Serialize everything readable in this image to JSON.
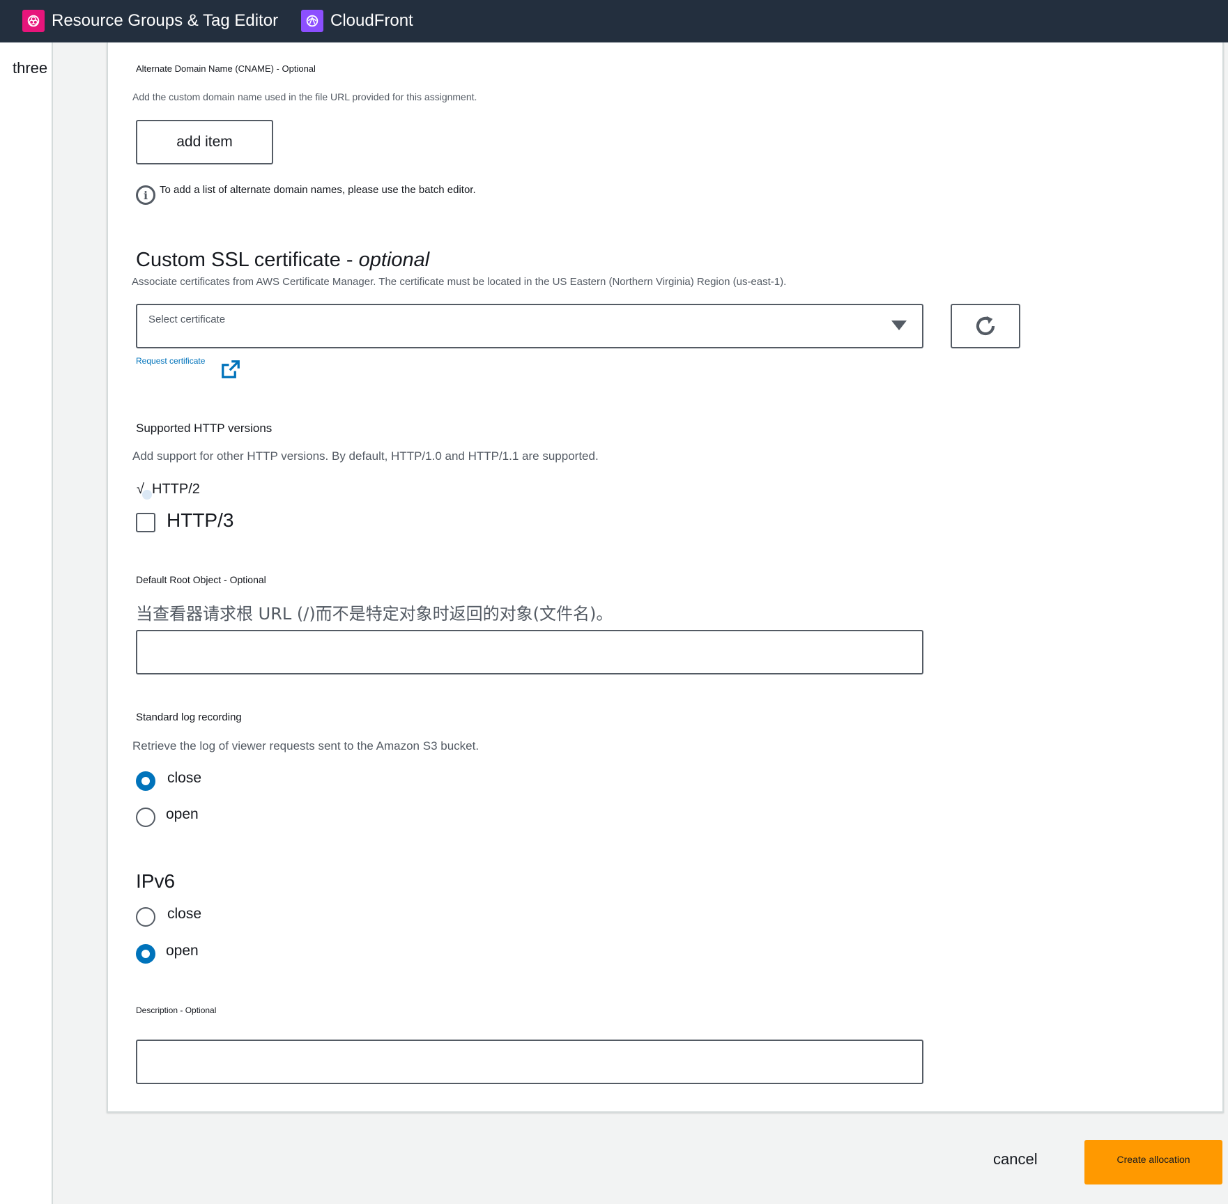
{
  "topbar": {
    "services": [
      {
        "label": "Resource Groups & Tag Editor",
        "icon": "resource-groups-icon",
        "color": "#e7157b"
      },
      {
        "label": "CloudFront",
        "icon": "cloudfront-icon",
        "color": "#8c4fff"
      }
    ]
  },
  "leftrail": {
    "text": "three"
  },
  "cname": {
    "label": "Alternate Domain Name (CNAME) - Optional",
    "description": "Add the custom domain name used in the file URL provided for this assignment.",
    "add_button": "add item",
    "info_text": "To add a list of alternate domain names, please use the batch editor."
  },
  "ssl": {
    "title": "Custom SSL certificate - ",
    "title_em": "optional",
    "description": "Associate certificates from AWS Certificate Manager. The certificate must be located in the US Eastern (Northern Virginia) Region (us-east-1).",
    "select_placeholder": "Select certificate",
    "request_link": "Request certificate"
  },
  "http": {
    "label": "Supported HTTP versions",
    "description": "Add support for other HTTP versions. By default, HTTP/1.0 and HTTP/1.1 are supported.",
    "opt_http2_mark": "√",
    "opt_http2": "HTTP/2",
    "opt_http3": "HTTP/3",
    "http2_checked": true,
    "http3_checked": false
  },
  "root_object": {
    "label": "Default Root Object - Optional",
    "description": "当查看器请求根 URL (/)而不是特定对象时返回的对象(文件名)。",
    "value": ""
  },
  "logging": {
    "label": "Standard log recording",
    "description": "Retrieve the log of viewer requests sent to the Amazon S3 bucket.",
    "options": [
      "close",
      "open"
    ],
    "selected": "close"
  },
  "ipv6": {
    "title": "IPv6",
    "options": [
      "close",
      "open"
    ],
    "selected": "open"
  },
  "description_field": {
    "label": "Description - Optional",
    "value": ""
  },
  "footer": {
    "cancel": "cancel",
    "create": "Create allocation",
    "accent": "#ff9900"
  }
}
